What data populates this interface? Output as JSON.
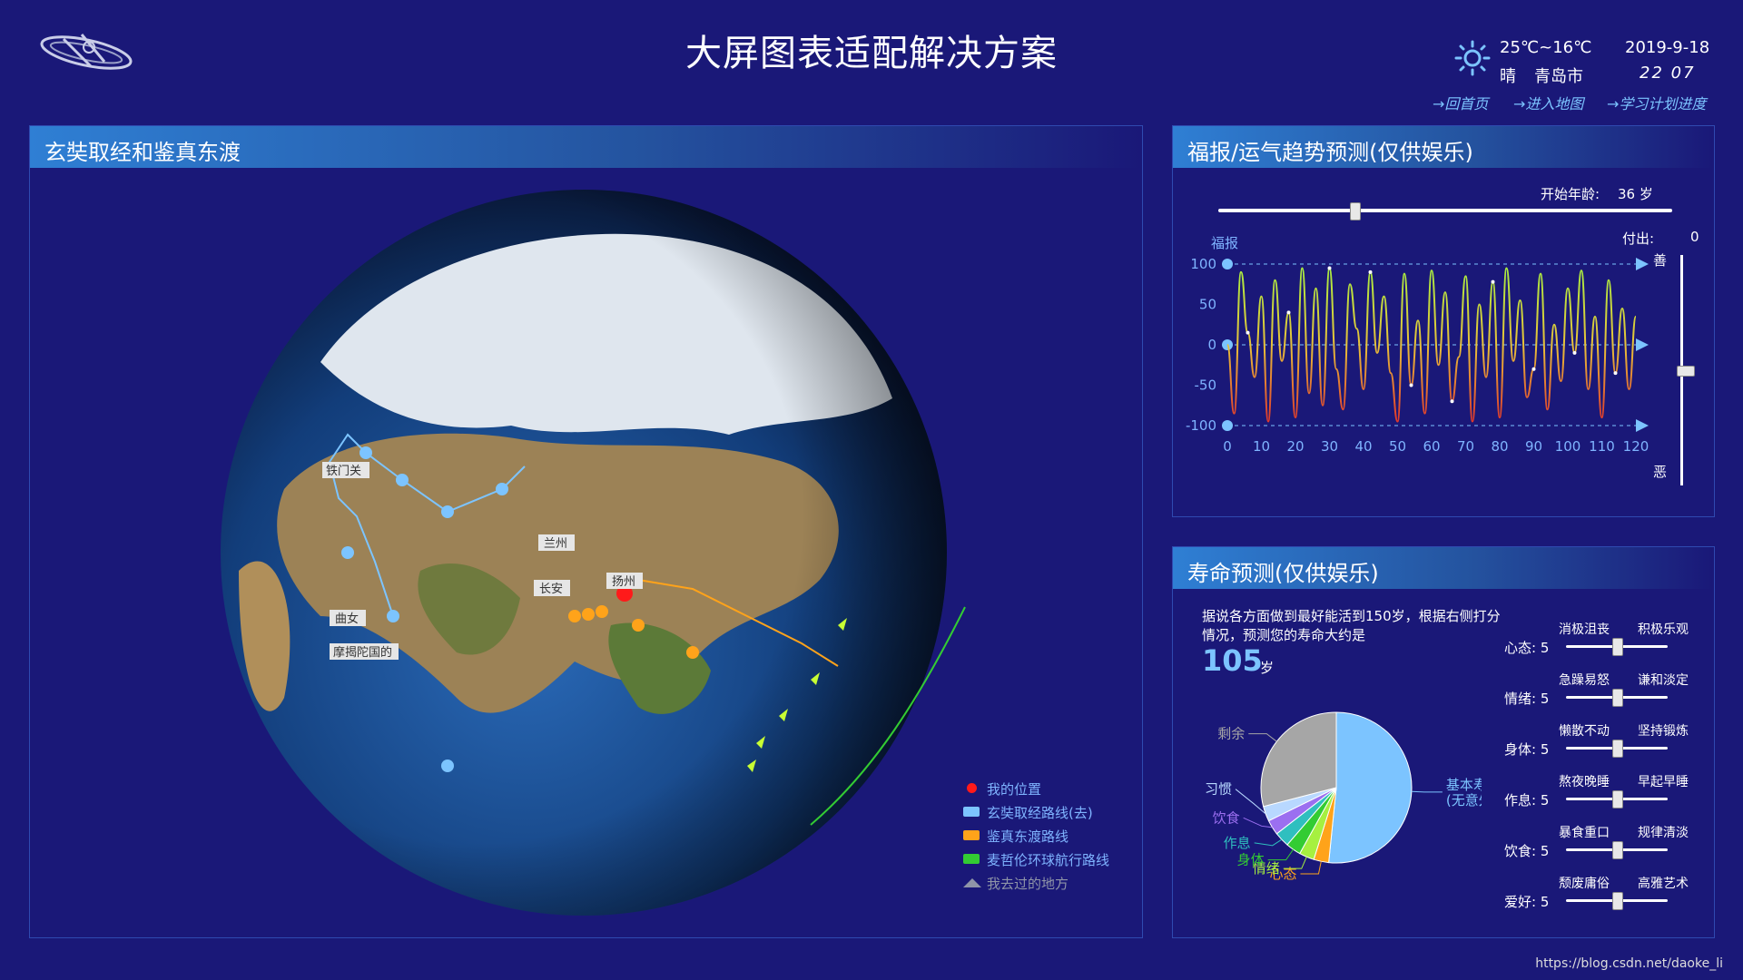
{
  "header": {
    "title": "大屏图表适配解决方案",
    "weather": {
      "temp": "25℃~16℃",
      "condition": "晴",
      "city": "青岛市"
    },
    "date": "2019-9-18",
    "time": "22 07",
    "nav": [
      "→回首页",
      "→进入地图",
      "→学习计划进度"
    ]
  },
  "globe_panel": {
    "title": "玄奘取经和鉴真东渡",
    "legend": [
      {
        "label": "我的位置",
        "color": "#ff1a1a",
        "shape": "dot"
      },
      {
        "label": "玄奘取经路线(去)",
        "color": "#7cc4ff",
        "shape": "rect"
      },
      {
        "label": "鉴真东渡路线",
        "color": "#ffa31a",
        "shape": "rect"
      },
      {
        "label": "麦哲伦环球航行路线",
        "color": "#33cc33",
        "shape": "rect"
      },
      {
        "label": "我去过的地方",
        "color": "#8f95a8",
        "shape": "tri"
      }
    ],
    "place_labels": [
      "铁门关",
      "兰州",
      "扬州",
      "长安",
      "曲女",
      "摩揭陀国的"
    ]
  },
  "fortune_panel": {
    "title": "福报/运气趋势预测(仅供娱乐)",
    "start_age_label": "开始年龄:",
    "start_age_value": "36 岁",
    "start_age_fraction": 0.3,
    "pay_label": "付出:",
    "pay_value": "0",
    "pay_fraction": 0.5,
    "good_label": "善",
    "bad_label": "恶",
    "chart_data": {
      "type": "line",
      "ylabel": "福报",
      "xlim": [
        0,
        120
      ],
      "ylim": [
        -100,
        100
      ],
      "xticks": [
        "0",
        "10",
        "20",
        "30",
        "40",
        "50",
        "60",
        "70",
        "80",
        "90",
        "100",
        "110",
        "120"
      ],
      "yticks": [
        "100",
        "50",
        "0",
        "-50",
        "-100"
      ],
      "series": [
        {
          "x": [
            0,
            2,
            4,
            6,
            8,
            10,
            12,
            14,
            16,
            18,
            20,
            22,
            24,
            26,
            28,
            30,
            32,
            34,
            36,
            38,
            40,
            42,
            44,
            46,
            48,
            50,
            52,
            54,
            56,
            58,
            60,
            62,
            64,
            66,
            68,
            70,
            72,
            74,
            76,
            78,
            80,
            82,
            84,
            86,
            88,
            90,
            92,
            94,
            96,
            98,
            100,
            102,
            104,
            106,
            108,
            110,
            112,
            114,
            116,
            118,
            120
          ],
          "y": [
            0,
            -85,
            90,
            15,
            -40,
            60,
            -95,
            80,
            -20,
            40,
            -90,
            95,
            -60,
            70,
            -75,
            95,
            -30,
            -80,
            75,
            20,
            -55,
            90,
            -10,
            60,
            -35,
            -95,
            88,
            -50,
            30,
            -85,
            92,
            -25,
            65,
            -70,
            -15,
            85,
            -95,
            50,
            -40,
            78,
            -90,
            95,
            -20,
            55,
            -65,
            -30,
            88,
            -80,
            25,
            -45,
            70,
            -10,
            92,
            -55,
            35,
            -90,
            80,
            -35,
            45,
            -55,
            35
          ]
        }
      ]
    }
  },
  "life_panel": {
    "title": "寿命预测(仅供娱乐)",
    "intro": "据说各方面做到最好能活到150岁，根据右侧打分情况，预测您的寿命大约是",
    "years": "105",
    "years_unit": "岁",
    "chart_data": {
      "type": "pie",
      "slices": [
        {
          "name": "基本寿命\n(无意外)",
          "value": 80,
          "color": "#7cc4ff"
        },
        {
          "name": "心态",
          "value": 5,
          "color": "#ffa31a"
        },
        {
          "name": "情绪",
          "value": 5,
          "color": "#a6f040"
        },
        {
          "name": "身体",
          "value": 5,
          "color": "#33cc33"
        },
        {
          "name": "作息",
          "value": 5,
          "color": "#2fbfbf"
        },
        {
          "name": "饮食",
          "value": 5,
          "color": "#9b6ff0"
        },
        {
          "name": "习惯",
          "value": 5,
          "color": "#b8d8ff"
        },
        {
          "name": "剩余",
          "value": 45,
          "color": "#a6a6a6"
        }
      ]
    },
    "sliders": [
      {
        "name": "心态",
        "value": "5",
        "left": "消极沮丧",
        "right": "积极乐观",
        "fraction": 0.5
      },
      {
        "name": "情绪",
        "value": "5",
        "left": "急躁易怒",
        "right": "谦和淡定",
        "fraction": 0.5
      },
      {
        "name": "身体",
        "value": "5",
        "left": "懒散不动",
        "right": "坚持锻炼",
        "fraction": 0.5
      },
      {
        "name": "作息",
        "value": "5",
        "left": "熬夜晚睡",
        "right": "早起早睡",
        "fraction": 0.5
      },
      {
        "name": "饮食",
        "value": "5",
        "left": "暴食重口",
        "right": "规律清淡",
        "fraction": 0.5
      },
      {
        "name": "爱好",
        "value": "5",
        "left": "颓废庸俗",
        "right": "高雅艺术",
        "fraction": 0.5
      }
    ]
  },
  "watermark": "https://blog.csdn.net/daoke_li"
}
